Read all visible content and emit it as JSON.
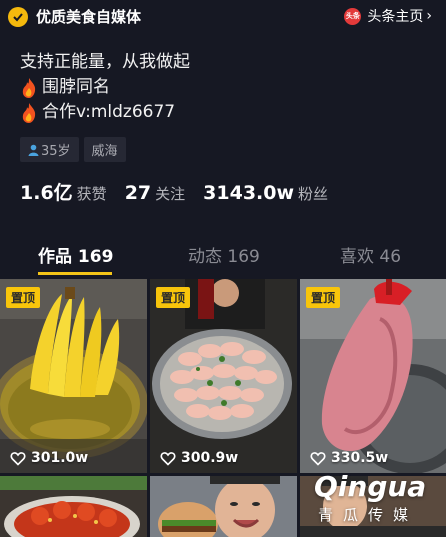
{
  "header": {
    "badge_text": "优质美食自媒体",
    "homepage_icon_text": "头条",
    "homepage_link": "头条主页",
    "chevron": "›"
  },
  "bio": {
    "line1": "支持正能量，从我做起",
    "line2": "围脖同名",
    "line3": "合作v:mldz6677"
  },
  "tags": {
    "age": "35岁",
    "city": "威海"
  },
  "stats": {
    "likes_num": "1.6亿",
    "likes_label": "获赞",
    "following_num": "27",
    "following_label": "关注",
    "followers_num": "3143.0w",
    "followers_label": "粉丝"
  },
  "tabs": {
    "works": "作品 169",
    "moments": "动态 169",
    "favorites": "喜欢 46"
  },
  "videos": [
    {
      "pinned": "置顶",
      "likes": "301.0w",
      "thumb": "bananas-in-wok"
    },
    {
      "pinned": "置顶",
      "likes": "300.9w",
      "thumb": "chicken-wings-tray"
    },
    {
      "pinned": "置顶",
      "likes": "330.5w",
      "thumb": "raw-meat-slab"
    },
    {
      "thumb": "crabs-dish"
    },
    {
      "thumb": "man-eating-burger"
    },
    {
      "thumb": "man-in-kitchen"
    }
  ],
  "watermark": {
    "logo": "Qingua",
    "sub": "青瓜传媒"
  },
  "colors": {
    "background": "#161823",
    "accent_yellow": "#f5c518",
    "pin_badge": "#f8c50b",
    "tag_bg": "#262834"
  }
}
